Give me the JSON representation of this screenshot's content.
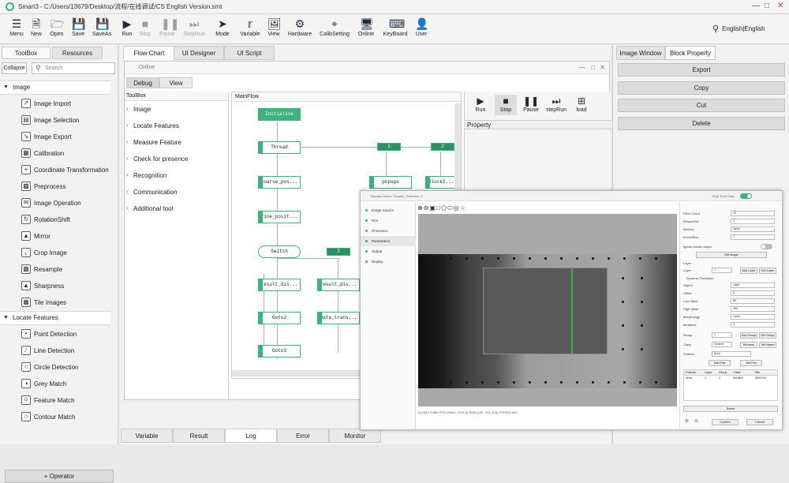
{
  "window": {
    "title": "Smart3 - C:/Users/13679/Desktop/流程/在线调试/CS English Version.smt"
  },
  "toolbar": {
    "items": [
      {
        "label": "Menu",
        "icon": "menu-icon"
      },
      {
        "label": "New",
        "icon": "new-file-icon"
      },
      {
        "label": "Open",
        "icon": "folder-open-icon"
      },
      {
        "label": "Save",
        "icon": "save-icon"
      },
      {
        "label": "SaveAs",
        "icon": "save-as-icon"
      },
      {
        "label": "Run",
        "icon": "play-icon"
      },
      {
        "label": "Stop",
        "icon": "stop-icon"
      },
      {
        "label": "Pause",
        "icon": "pause-icon"
      },
      {
        "label": "StepRun",
        "icon": "step-icon"
      },
      {
        "label": "Mode",
        "icon": "cursor-icon"
      },
      {
        "label": "Variable",
        "icon": "variable-icon"
      },
      {
        "label": "View",
        "icon": "view-icon"
      },
      {
        "label": "Hardware",
        "icon": "hardware-icon"
      },
      {
        "label": "CalibSetting",
        "icon": "calib-icon"
      },
      {
        "label": "Online",
        "icon": "online-icon"
      },
      {
        "label": "KeyBoard",
        "icon": "keyboard-icon"
      },
      {
        "label": "User",
        "icon": "user-icon"
      }
    ],
    "language": "English|English"
  },
  "left": {
    "tabs": [
      "ToolBox",
      "Resources"
    ],
    "collapse": "Collapse",
    "search_placeholder": "Search",
    "cat_image": "Image",
    "cat_locate": "Locate Features",
    "image_items": [
      "Image Import",
      "Image Selection",
      "Image Export",
      "Calibration",
      "Coordinate Transformation",
      "Preprocess",
      "Image Operation",
      "RotationShift",
      "Mirror",
      "Crop Image",
      "Resample",
      "Sharpness",
      "Tile Images"
    ],
    "locate_items": [
      "Point Detection",
      "Line Detection",
      "Circle Detection",
      "Grey Match",
      "Feature Match",
      "Contour Match"
    ],
    "operator_button": "+ Operator"
  },
  "center": {
    "tabs": [
      "Flow Chart",
      "UI Designer",
      "UI Script"
    ],
    "online_title": "Online",
    "subtabs": [
      "Debug",
      "View"
    ],
    "toolbox_header": "ToolBox",
    "toolbox_items": [
      "Image",
      "Locate Features",
      "Measure Feature",
      "Check for presence",
      "Recognition",
      "Communication",
      "Additional tool"
    ],
    "flow_header": "MainFlow",
    "nodes": {
      "initialize": "Initialize",
      "thread": "Thread",
      "coarse": "coarse_pos...",
      "fine": "fine_posit...",
      "switch": "Switch",
      "result1": "result_dis...",
      "result2": "result_dis...",
      "goto2": "Goto2",
      "data": "data_trans...",
      "goto3": "Goto3",
      "popups": "popups",
      "block": "Block2..."
    },
    "tags": [
      "1",
      "2",
      "2",
      "3"
    ],
    "run_buttons": [
      "Run",
      "Stop",
      "Pause",
      "stepRun",
      "load"
    ],
    "property_header": "Property",
    "bottom_tabs": [
      "Variable",
      "Result",
      "Log",
      "Error",
      "Monitor"
    ]
  },
  "right": {
    "tabs": [
      "Image Window",
      "Block Property"
    ],
    "buttons": [
      "Export",
      "Copy",
      "Cut",
      "Delete"
    ]
  },
  "overlay": {
    "title": "Operator Name: Scratch_Detection_1",
    "nav": [
      "Image Source",
      "ROI",
      "Processor",
      "Parameters",
      "Output",
      "Display"
    ],
    "real_time": "Real Time Data",
    "status": "W:2640 H:960 POS:(908.4, 1016.5) RGB:(100, 103, 103) ZOOM:0.563",
    "props": [
      {
        "label": "Filter Count",
        "value": "30"
      },
      {
        "label": "ResizeSize",
        "value": "2"
      },
      {
        "label": "Method",
        "value": "Mean"
      },
      {
        "label": "KernelSize",
        "value": "7"
      }
    ],
    "ignore_border": "Ignore border object",
    "diff_image": "Diff Image",
    "layer_label": "Layer",
    "layer_value": "1",
    "add_layer": "Add Layer",
    "del_layer": "Del Layer",
    "dyn_threshold": "Dynamic Threshold",
    "dyn_props": [
      {
        "label": "Object",
        "value": "Light"
      },
      {
        "label": "Offset",
        "value": "5"
      },
      {
        "label": "Low Value",
        "value": "80"
      },
      {
        "label": "High Value",
        "value": "255"
      },
      {
        "label": "Morphology",
        "value": "Open"
      },
      {
        "label": "Iterations",
        "value": "3"
      }
    ],
    "group_label": "Group",
    "group_value": "1",
    "add_group": "Add Group",
    "del_group": "Del Group",
    "class_label": "Class",
    "class_value": "Scratch",
    "rename": "Rename",
    "del_name": "Del Name",
    "feature_label": "Feature",
    "feature_value": "Area",
    "add_fea": "Add Fea",
    "del_fea": "Del Fea",
    "table_headers": [
      "Feature",
      "Layer",
      "Group",
      "Class",
      "Min"
    ],
    "table_row": [
      "Area",
      "1",
      "1",
      "Scratch",
      "5000.00"
    ],
    "select": "Select",
    "confirm": "Confirm",
    "cancel": "Cancel"
  }
}
